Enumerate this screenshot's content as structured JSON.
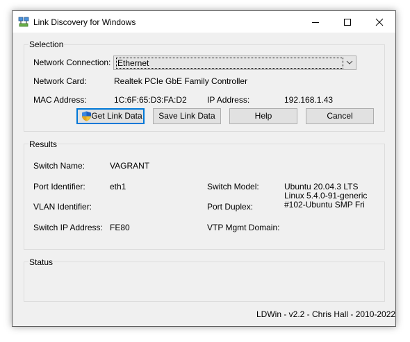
{
  "window": {
    "title": "Link Discovery for Windows"
  },
  "selection": {
    "legend": "Selection",
    "network_connection_label": "Network Connection:",
    "network_connection_value": "Ethernet",
    "network_card_label": "Network Card:",
    "network_card_value": "Realtek PCIe GbE Family Controller",
    "mac_label": "MAC Address:",
    "mac_value": "1C:6F:65:D3:FA:D2",
    "ip_label": "IP Address:",
    "ip_value": "192.168.1.43"
  },
  "buttons": {
    "get_link_data": "Get Link Data",
    "save_link_data": "Save Link Data",
    "help": "Help",
    "cancel": "Cancel"
  },
  "results": {
    "legend": "Results",
    "switch_name_label": "Switch Name:",
    "switch_name_value": "VAGRANT",
    "port_identifier_label": "Port Identifier:",
    "port_identifier_value": "eth1",
    "switch_model_label": "Switch Model:",
    "switch_model_lines": [
      "Ubuntu 20.04.3 LTS",
      "Linux 5.4.0-91-generic",
      "#102-Ubuntu SMP Fri"
    ],
    "vlan_identifier_label": "VLAN Identifier:",
    "vlan_identifier_value": "",
    "port_duplex_label": "Port Duplex:",
    "port_duplex_value": "",
    "switch_ip_label": "Switch IP Address:",
    "switch_ip_value": "FE80",
    "vtp_label": "VTP Mgmt Domain:",
    "vtp_value": ""
  },
  "status": {
    "legend": "Status",
    "text": ""
  },
  "footer": {
    "text": "LDWin - v2.2 - Chris Hall - 2010-2022"
  }
}
